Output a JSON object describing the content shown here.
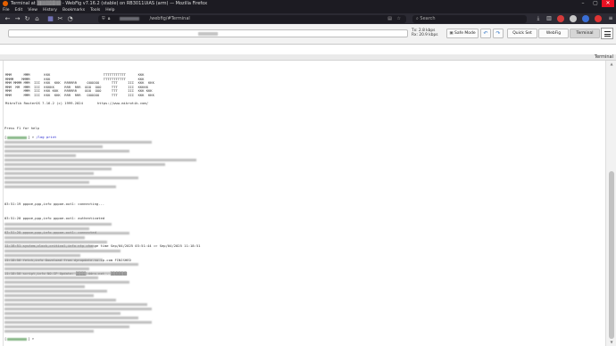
{
  "window": {
    "title": "Terminal at ▒▒▒▒▒▒▒ - WebFig v7.16.2 (stable) on RB3011UiAS (arm) — Mozilla Firefox",
    "controls": [
      "–",
      "▢",
      "✕"
    ]
  },
  "menu": [
    "File",
    "Edit",
    "View",
    "History",
    "Bookmarks",
    "Tools",
    "Help"
  ],
  "browser": {
    "url_text": "/webfig/#Terminal",
    "search_placeholder": "Search",
    "icons": [
      "back-icon",
      "forward-icon",
      "reload-icon",
      "home-icon",
      "shield-icon",
      "lock-icon",
      "bookmark-star-icon",
      "extensions-icon",
      "account-icon",
      "menu-icon"
    ],
    "accent": "#2b2a33"
  },
  "webfig": {
    "rates": {
      "tx": "Tx: 2.8 kbps",
      "rx": "Rx: 20.9 kbps"
    },
    "buttons": {
      "safe_mode": "Safe Mode",
      "undo": "↶",
      "redo": "↷",
      "quick_set": "Quick Set",
      "webfig": "WebFig",
      "terminal": "Terminal"
    },
    "section_label": "Terminal"
  },
  "terminal": {
    "logo_lines": [
      "MMM      MMM       KKK                          TTTTTTTTTTT      KKK",
      "MMMM    MMMM       KKK                          TTTTTTTTTTT      KKK",
      "MMM MMMM MMM  III  KKK  KKK  RRRRRR     OOOOOO      TTT     III  KKK  KKK",
      "MMM  MM  MMM  III  KKKKK     RRR  RRR  OOO  OOO     TTT     III  KKKKK",
      "MMM      MMM  III  KKK KKK   RRRRRR    OOO  OOO     TTT     III  KKK KKK",
      "MMM      MMM  III  KKK  KKK  RRR  RRR   OOOOOO      TTT     III  KKK  KKK",
      "",
      "MikroTik RouterOS 7.16.2 (c) 1999-2024       https://www.mikrotik.com/"
    ],
    "help_hint": "Press F1 for help",
    "prompt_tail": "] > ",
    "command": "/log print",
    "log_lines": [
      "03:51:19 pppoe,ppp,info pppoe-out1: connecting...",
      "03:51:20 pppoe,ppp,info pppoe-out1: authenticated",
      "03:51:20 pppoe,ppp,info pppoe-out1: connected",
      "11:18:51 system,clock,critical,info ntp change time Sep/04/2025 03:51:44 => Sep/04/2025 11:18:51",
      "11:18:56 fetch,info Download from dynupdate.no-ip.com FINISHED",
      "11:18:56 script,info NO-IP Update: ▒▒▒▒▒.ddns.net - ▒▒▒▒▒▒▒▒"
    ],
    "final_prompt_tail": "] > "
  }
}
